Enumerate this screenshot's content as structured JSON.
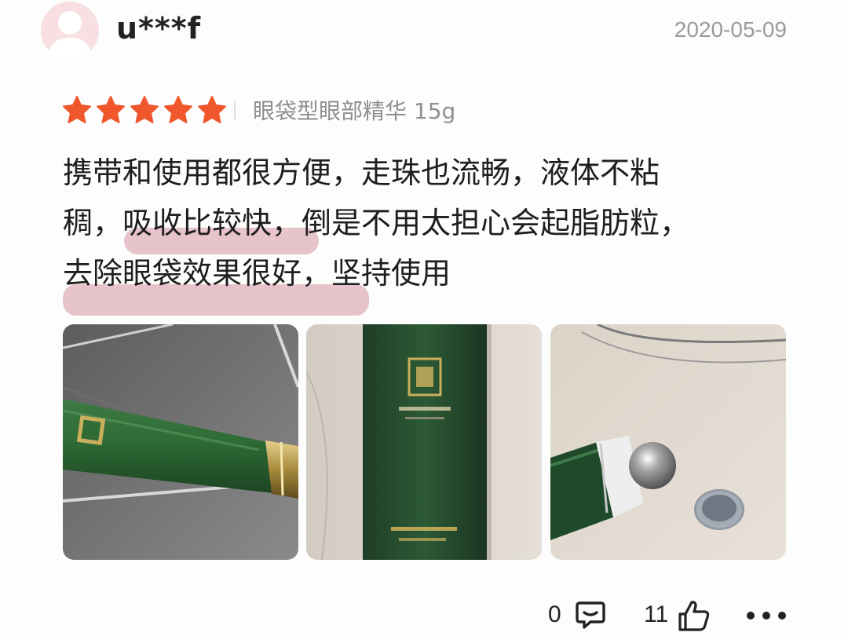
{
  "review": {
    "username": "u***f",
    "date": "2020-05-09",
    "rating": 5,
    "rating_max": 5,
    "variant": "眼袋型眼部精华 15g",
    "text": "携带和使用都很方便，走珠也流畅，液体不粘稠，吸收比较快，倒是不用太担心会起脂肪粒，去除眼袋效果很好，坚持使用",
    "text_lines": [
      "携带和使用都很方便，走珠也流畅，液体不粘",
      "稠，吸收比较快，倒是不用太担心会起脂肪粒，",
      "去除眼袋效果很好，坚持使用"
    ]
  },
  "photos": [
    {
      "icon": "product-tube-photo"
    },
    {
      "icon": "product-box-photo"
    },
    {
      "icon": "roller-ball-photo"
    }
  ],
  "footer": {
    "comment_count": "0",
    "like_count": "11",
    "comment_icon": "comment-icon",
    "like_icon": "thumbs-up-icon",
    "more_icon": "more-icon"
  },
  "colors": {
    "star": "#f0572c",
    "highlight": "#d696a0",
    "avatar_bg": "#f7dfe2",
    "product_green": "#2c5a35"
  }
}
